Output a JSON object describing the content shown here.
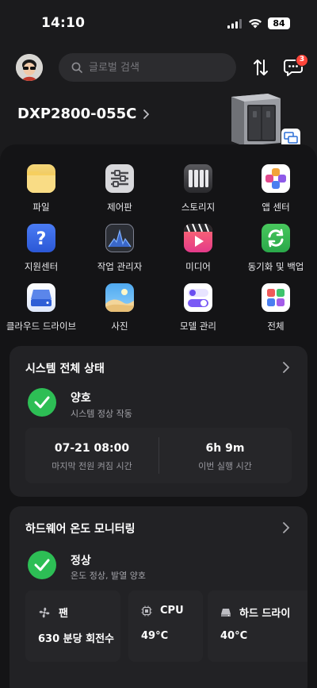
{
  "status_bar": {
    "time": "14:10",
    "battery": "84"
  },
  "header": {
    "search_placeholder": "글로벌 검색",
    "notification_count": "3"
  },
  "device": {
    "name": "DXP2800-055C"
  },
  "apps": [
    {
      "label": "파일",
      "icon": "folder-icon"
    },
    {
      "label": "제어판",
      "icon": "sliders-icon"
    },
    {
      "label": "스토리지",
      "icon": "storage-icon"
    },
    {
      "label": "앱 센터",
      "icon": "app-center-icon"
    },
    {
      "label": "지원센터",
      "icon": "help-icon"
    },
    {
      "label": "작업 관리자",
      "icon": "activity-icon"
    },
    {
      "label": "미디어",
      "icon": "media-icon"
    },
    {
      "label": "동기화 및 백업",
      "icon": "sync-icon"
    },
    {
      "label": "클라우드 드라이브",
      "icon": "cloud-drive-icon"
    },
    {
      "label": "사진",
      "icon": "photos-icon"
    },
    {
      "label": "모델 관리",
      "icon": "model-toggle-icon"
    },
    {
      "label": "전체",
      "icon": "all-apps-icon"
    }
  ],
  "system_status": {
    "title": "시스템 전체 상태",
    "state": "양호",
    "state_sub": "시스템 정상 작동",
    "last_power_on_value": "07-21 08:00",
    "last_power_on_label": "마지막 전원 켜짐 시간",
    "uptime_value": "6h 9m",
    "uptime_label": "이번 실행 시간"
  },
  "hardware": {
    "title": "하드웨어 온도 모니터링",
    "state": "정상",
    "state_sub": "온도 정상, 발열 양호",
    "fan_label": "팬",
    "fan_value": "630 분당 회전수",
    "cpu_label": "CPU",
    "cpu_value": "49°C",
    "drive_label": "하드 드라이",
    "drive_value": "40°C"
  },
  "colors": {
    "accent_green": "#2dbe55",
    "badge_red": "#ff453a",
    "background": "#1b1b1d",
    "card": "#222225"
  }
}
